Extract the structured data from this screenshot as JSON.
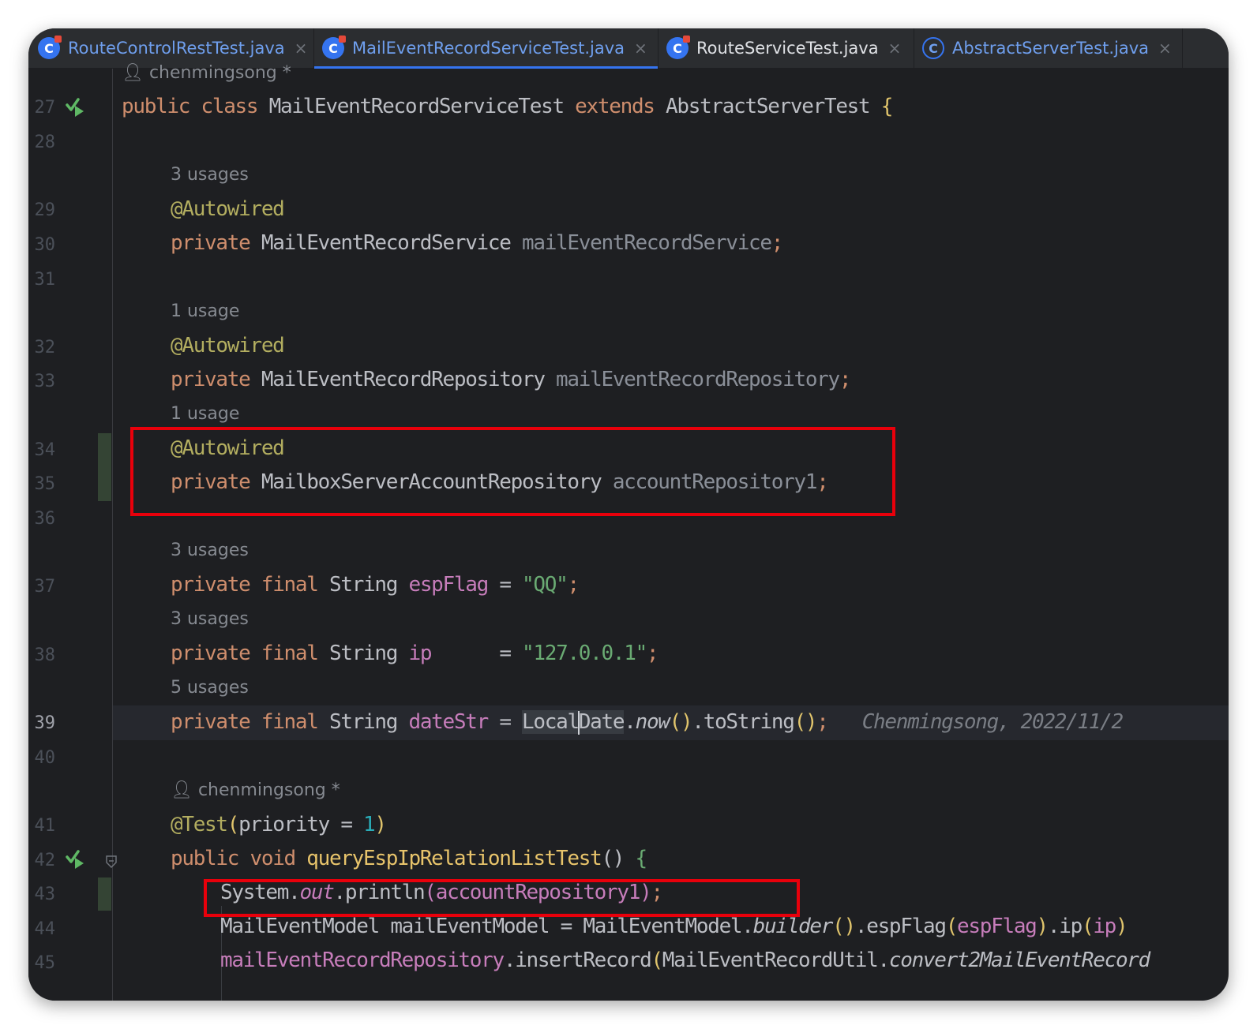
{
  "tabs": [
    {
      "name": "RouteControlRestTest.java",
      "icon": "java-class-icon",
      "active": false
    },
    {
      "name": "MailEventRecordServiceTest.java",
      "icon": "java-class-icon",
      "active": true
    },
    {
      "name": "RouteServiceTest.java",
      "icon": "java-class-icon",
      "active": false
    },
    {
      "name": "AbstractServerTest.java",
      "icon": "java-abstract-class-icon",
      "active": false
    }
  ],
  "close_glyph": "×",
  "line_numbers": [
    "27",
    "28",
    "29",
    "30",
    "31",
    "32",
    "33",
    "34",
    "35",
    "36",
    "37",
    "38",
    "39",
    "40",
    "41",
    "42",
    "43",
    "44",
    "45"
  ],
  "current_line": "39",
  "hints": {
    "author_top": "chenmingsong *",
    "usages_3": "3 usages",
    "usage_1a": "1 usage",
    "usage_1b": "1 usage",
    "usages_3b": "3 usages",
    "usages_3c": "3 usages",
    "usages_5": "5 usages",
    "author_method": "chenmingsong *"
  },
  "code": {
    "l27": {
      "kw1": "public",
      "kw2": "class",
      "cls": "MailEventRecordServiceTest",
      "kw3": "extends",
      "sup": "AbstractServerTest",
      "br": "{"
    },
    "l29": {
      "ann": "@Autowired"
    },
    "l30": {
      "kw": "private",
      "type": "MailEventRecordService",
      "field": "mailEventRecordService",
      "semi": ";"
    },
    "l32": {
      "ann": "@Autowired"
    },
    "l33": {
      "kw": "private",
      "type": "MailEventRecordRepository",
      "field": "mailEventRecordRepository",
      "semi": ";"
    },
    "l34": {
      "ann": "@Autowired"
    },
    "l35": {
      "kw": "private",
      "type": "MailboxServerAccountRepository",
      "field": "accountRepository1",
      "semi": ";"
    },
    "l37": {
      "kw1": "private",
      "kw2": "final",
      "type": "String",
      "field": "espFlag",
      "eq": "=",
      "str": "\"QQ\"",
      "semi": ";"
    },
    "l38": {
      "kw1": "private",
      "kw2": "final",
      "type": "String",
      "field": "ip",
      "eq": "=",
      "str": "\"127.0.0.1\"",
      "semi": ";"
    },
    "l39": {
      "kw1": "private",
      "kw2": "final",
      "type": "String",
      "field": "dateStr",
      "eq": "=",
      "cls_a": "Local",
      "cls_b": "Date",
      "dot": ".",
      "method": "now",
      "paren": "()",
      "rest": ".toString",
      "paren2": "()",
      "semi": ";",
      "blame": "Chenmingsong, 2022/11/2"
    },
    "l41": {
      "ann": "@Test",
      "open": "(",
      "param": "priority",
      "eq": "=",
      "num": "1",
      "close": ")"
    },
    "l42": {
      "kw1": "public",
      "kw2": "void",
      "method": "queryEspIpRelationListTest",
      "paren": "()",
      "br": "{"
    },
    "l43": {
      "sys": "System.",
      "out": "out",
      "println": ".println",
      "open": "(",
      "arg": "accountRepository1",
      "close": ")",
      "semi": ";"
    },
    "l44": {
      "type": "MailEventModel",
      "var": "mailEventModel",
      "eq": "=",
      "cls": "MailEventModel.",
      "builder": "builder",
      "p1": "()",
      "esp": ".espFlag",
      "o1": "(",
      "a1": "espFlag",
      "c1": ")",
      "ipm": ".ip",
      "o2": "(",
      "a2": "ip",
      "c2": ")"
    },
    "l45": {
      "field": "mailEventRecordRepository",
      "call": ".insertRecord",
      "open": "(",
      "util": "MailEventRecordUtil.",
      "conv": "convert2MailEventRecord"
    }
  },
  "colors": {
    "keyword": "#cf8e6d",
    "annotation": "#b3ae60",
    "field": "#c77dbb",
    "string": "#6aab73",
    "number": "#2aacb8",
    "highlight": "#e8000b"
  }
}
